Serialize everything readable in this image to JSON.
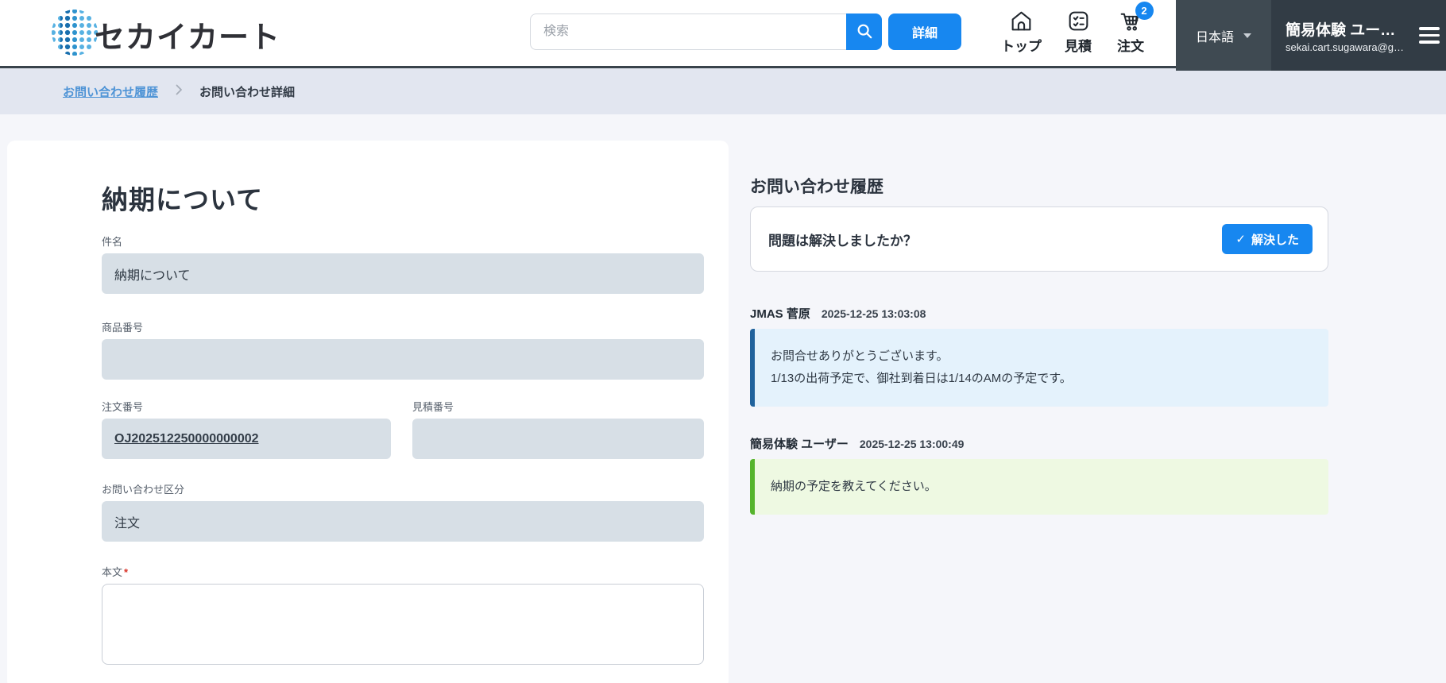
{
  "header": {
    "logo_text": "セカイカート",
    "search": {
      "placeholder": "検索",
      "detail_button": "詳細"
    },
    "nav": [
      {
        "label": "トップ",
        "icon": "home-icon"
      },
      {
        "label": "見積",
        "icon": "checklist-icon"
      },
      {
        "label": "注文",
        "icon": "cart-icon",
        "badge": "2"
      }
    ],
    "language": {
      "label": "日本語"
    },
    "user": {
      "name": "簡易体験 ユー…",
      "email": "sekai.cart.sugawara@g…"
    }
  },
  "breadcrumb": {
    "link": "お問い合わせ履歴",
    "current": "お問い合わせ詳細"
  },
  "form": {
    "title": "納期について",
    "subject": {
      "label": "件名",
      "value": "納期について"
    },
    "product_no": {
      "label": "商品番号",
      "value": ""
    },
    "order_no": {
      "label": "注文番号",
      "value": "OJ202512250000000002"
    },
    "quote_no": {
      "label": "見積番号",
      "value": ""
    },
    "category": {
      "label": "お問い合わせ区分",
      "value": "注文"
    },
    "body": {
      "label": "本文",
      "required_mark": "*",
      "value": ""
    }
  },
  "history": {
    "title": "お問い合わせ履歴",
    "resolve": {
      "question": "問題は解決しましたか？",
      "check": "✓",
      "button_label": "解決した"
    },
    "messages": [
      {
        "author": "JMAS 菅原",
        "timestamp": "2025-12-25 13:03:08",
        "line1": "お問合せありがとうございます。",
        "line2": "1/13の出荷予定で、御社到着日は1/14のAMの予定です。"
      },
      {
        "author": "簡易体験 ユーザー",
        "timestamp": "2025-12-25 13:00:49",
        "line1": "納期の予定を教えてください。"
      }
    ]
  },
  "colors": {
    "accent_blue": "#1787f0",
    "header_dark": "#323c45",
    "language_block_bg": "#3f4a52",
    "breadcrumb_bg": "#e2e6f0",
    "breadcrumb_link": "#4f94d6",
    "page_bg": "#f5f6fa",
    "filled_field_bg": "#d7dfe6",
    "staff_message_bg": "#e4f2fc",
    "staff_message_border": "#20629c",
    "user_message_bg": "#eef9e2",
    "user_message_border": "#55b42c",
    "required_red": "#d93025"
  }
}
